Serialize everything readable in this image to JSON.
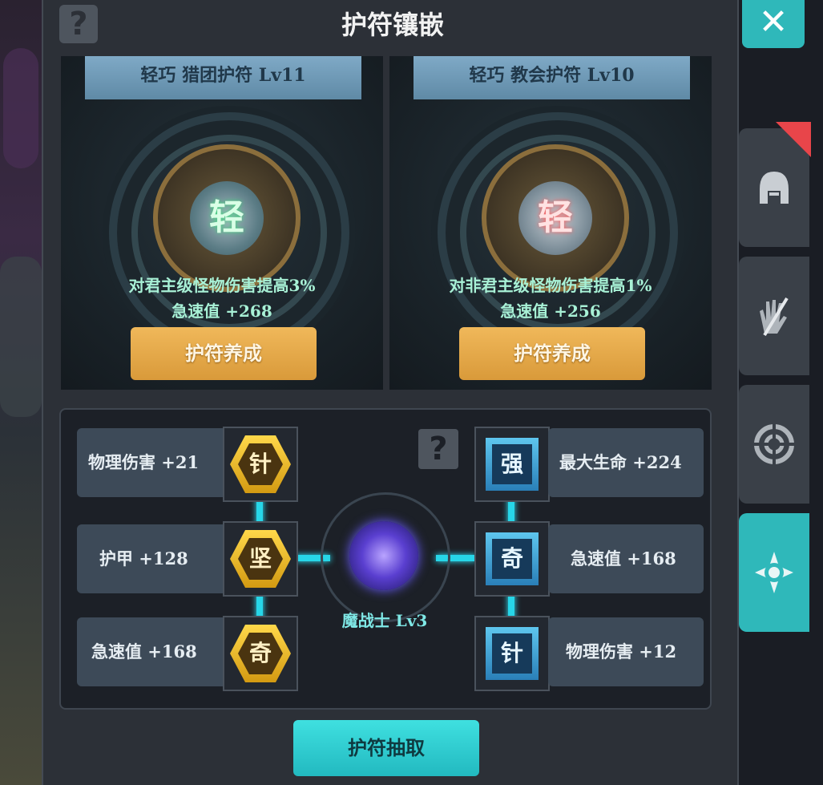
{
  "header": {
    "title": "护符镶嵌",
    "help_icon": "question-mark-icon",
    "close_icon": "close-x-icon"
  },
  "amulets": [
    {
      "name": "轻巧  猎团护符  Lv11",
      "gem_char": "轻",
      "gem_color": "#3bd37a",
      "effect": "对君主级怪物伤害提高3%",
      "stat": "急速值  +268",
      "button": "护符养成"
    },
    {
      "name": "轻巧  教会护符  Lv10",
      "gem_char": "轻",
      "gem_color": "#ff5a5a",
      "effect": "对非君主级怪物伤害提高1%",
      "stat": "急速值  +256",
      "button": "护符养成"
    }
  ],
  "links": {
    "left": [
      {
        "label": "物理伤害  +21",
        "rune": "针"
      },
      {
        "label": "护甲  +128",
        "rune": "坚"
      },
      {
        "label": "急速值  +168",
        "rune": "奇"
      }
    ],
    "right": [
      {
        "label": "最大生命  +224",
        "rune": "强"
      },
      {
        "label": "急速值  +168",
        "rune": "奇"
      },
      {
        "label": "物理伤害  +12",
        "rune": "针"
      }
    ],
    "core_label": "魔战士  Lv3"
  },
  "extract_button": "护符抽取",
  "tabs": [
    {
      "icon": "helmet-icon",
      "badge": true
    },
    {
      "icon": "gloves-icon",
      "badge": false
    },
    {
      "icon": "target-icon",
      "badge": false
    },
    {
      "icon": "amulet-icon",
      "badge": false,
      "active": true
    }
  ],
  "colors": {
    "accent": "#2fb8ba",
    "gold": "#f0b85a",
    "link": "#27d6e8"
  }
}
